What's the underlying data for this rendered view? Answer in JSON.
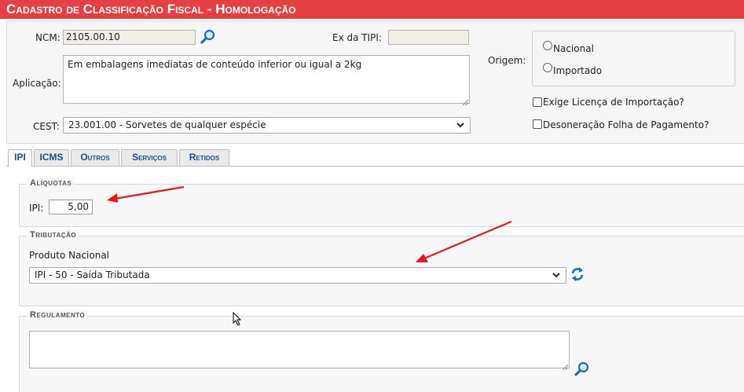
{
  "window": {
    "title": "Cadastro de Classificação Fiscal  - Homologação"
  },
  "form": {
    "ncm_label": "NCM:",
    "ncm_value": "2105.00.10",
    "ex_tipi_label": "Ex da TIPI:",
    "ex_tipi_value": "",
    "aplicacao_label": "Aplicação:",
    "aplicacao_value": "Em embalagens imediatas de conteúdo inferior ou igual a 2kg",
    "cest_label": "CEST:",
    "cest_value": "23.001.00 - Sorvetes de qualquer espécie",
    "origem_label": "Origem:",
    "origem_options": [
      "Nacional",
      "Importado"
    ],
    "exige_licenca_label": "Exige Licença de Importação?",
    "desoneracao_label": "Desoneração Folha de Pagamento?"
  },
  "tabs": [
    {
      "label": "IPI",
      "active": true
    },
    {
      "label": "ICMS"
    },
    {
      "label": "Outros"
    },
    {
      "label": "Serviços"
    },
    {
      "label": "Retidos"
    }
  ],
  "aliquotas": {
    "legend": "Alíquotas",
    "ipi_label": "IPI:",
    "ipi_value": "5,00"
  },
  "tributacao": {
    "legend": "Tributação",
    "produto_label": "Produto Nacional",
    "select_value": "IPI - 50 - Saída Tributada"
  },
  "regulamento": {
    "legend": "Regulamento",
    "value": ""
  },
  "colors": {
    "title_bar": "#e63f43",
    "annotation_arrow": "#e3191e",
    "icon_blue": "#1f6fb8"
  }
}
